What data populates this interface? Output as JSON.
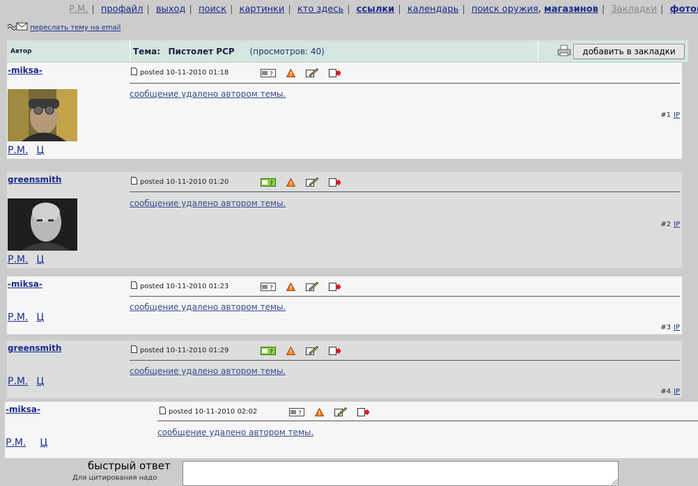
{
  "nav": {
    "items": [
      {
        "label": "Р.М.",
        "style": "dim"
      },
      {
        "label": "профайл",
        "style": "normal"
      },
      {
        "label": "выход",
        "style": "normal"
      },
      {
        "label": "поиск",
        "style": "normal"
      },
      {
        "label": "картинки",
        "style": "normal"
      },
      {
        "label": "кто здесь",
        "style": "normal"
      },
      {
        "label": "ссылки",
        "style": "bold"
      },
      {
        "label": "календарь",
        "style": "normal"
      },
      {
        "label": "поиск оружия",
        "style": "normal"
      },
      {
        "label": "магазинов",
        "style": "bold"
      },
      {
        "label": "Закладки",
        "style": "dim"
      },
      {
        "label": "фотокон",
        "style": "bold"
      }
    ]
  },
  "email": {
    "label": "переслать тему на email"
  },
  "header": {
    "author_label": "Автор",
    "topic_prefix": "Тема:",
    "topic_title": "Пистолет PCP",
    "views": "(просмотров: 40)",
    "bookmark_button": "добавить в закладки"
  },
  "posts": [
    {
      "author": "-miksa-",
      "posted": "posted 10-11-2010 01:18",
      "message": "сообщение удалено автором темы.",
      "num": "#1",
      "ip": "IP",
      "links": [
        "Р.М.",
        "Ц"
      ]
    },
    {
      "author": "greensmith",
      "posted": "posted 10-11-2010 01:20",
      "message": "сообщение удалено автором темы.",
      "num": "#2",
      "ip": "IP",
      "links": [
        "Р.М.",
        "Ц"
      ]
    },
    {
      "author": "-miksa-",
      "posted": "posted 10-11-2010 01:23",
      "message": "сообщение удалено автором темы.",
      "num": "#3",
      "ip": "IP",
      "links": [
        "Р.М.",
        "Ц"
      ]
    },
    {
      "author": "greensmith",
      "posted": "posted 10-11-2010 01:29",
      "message": "сообщение удалено автором темы.",
      "num": "#4",
      "ip": "IP",
      "links": [
        "Р.М.",
        "Ц"
      ]
    },
    {
      "author": "-miksa-",
      "posted": "posted 10-11-2010 02:02",
      "message": "сообщение удалено автором темы.",
      "num": "",
      "ip": "",
      "links": [
        "Р.М.",
        "Ц"
      ]
    }
  ],
  "quick_reply": {
    "label": "быстрый ответ",
    "hint": "Для цитирования надо"
  },
  "colors": {
    "link": "#1a2a8a",
    "header_bg": "#d6e5e0",
    "row_light": "#f6f6f6",
    "row_grey": "#dcdddd"
  }
}
